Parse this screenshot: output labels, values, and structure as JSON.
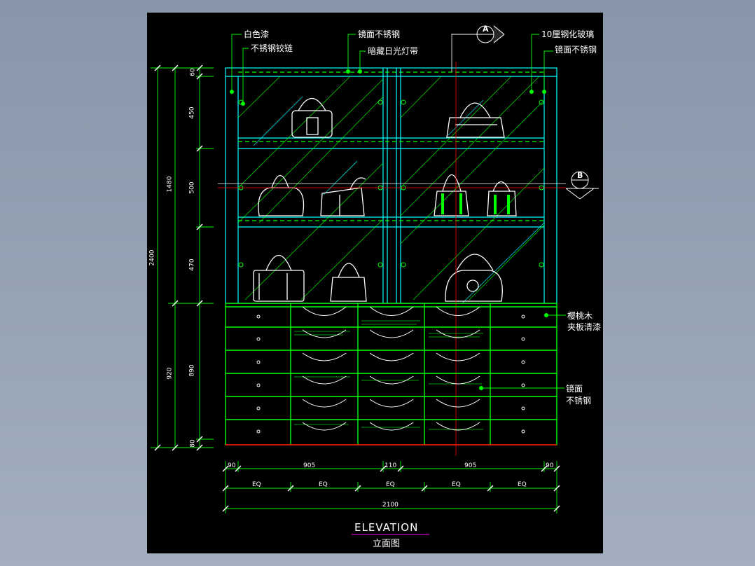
{
  "title": {
    "en": "ELEVATION",
    "cn": "立面图"
  },
  "callouts": {
    "white_paint": "白色漆",
    "ss_hinge": "不锈钢铰链",
    "mirror_ss_top": "镜面不锈钢",
    "hidden_light": "暗藏日光灯带",
    "tempered_glass": "10厘钢化玻璃",
    "mirror_ss_right": "镜面不锈钢",
    "cherry_1": "樱桃木",
    "cherry_2": "夹板清漆",
    "mirror_ss_low_1": "镜面",
    "mirror_ss_low_2": "不锈钢"
  },
  "section_markers": {
    "a": "A",
    "b": "B"
  },
  "dims_left_inner": [
    "60",
    "450",
    "500",
    "470",
    "890",
    "80"
  ],
  "dims_left_mid": [
    "1480",
    "920"
  ],
  "dims_left_outer": "2400",
  "dims_bottom_row1": [
    "90",
    "905",
    "110",
    "905",
    "90"
  ],
  "dims_bottom_row2": [
    "EQ",
    "EQ",
    "EQ",
    "EQ",
    "EQ"
  ],
  "dims_total": "2100",
  "colors": {
    "green": "#00ff00",
    "cyan": "#00ffff",
    "white": "#ffffff",
    "red": "#ff0000",
    "magenta": "#ff00ff",
    "sheet": "#000000",
    "background": "#8e9db0"
  }
}
